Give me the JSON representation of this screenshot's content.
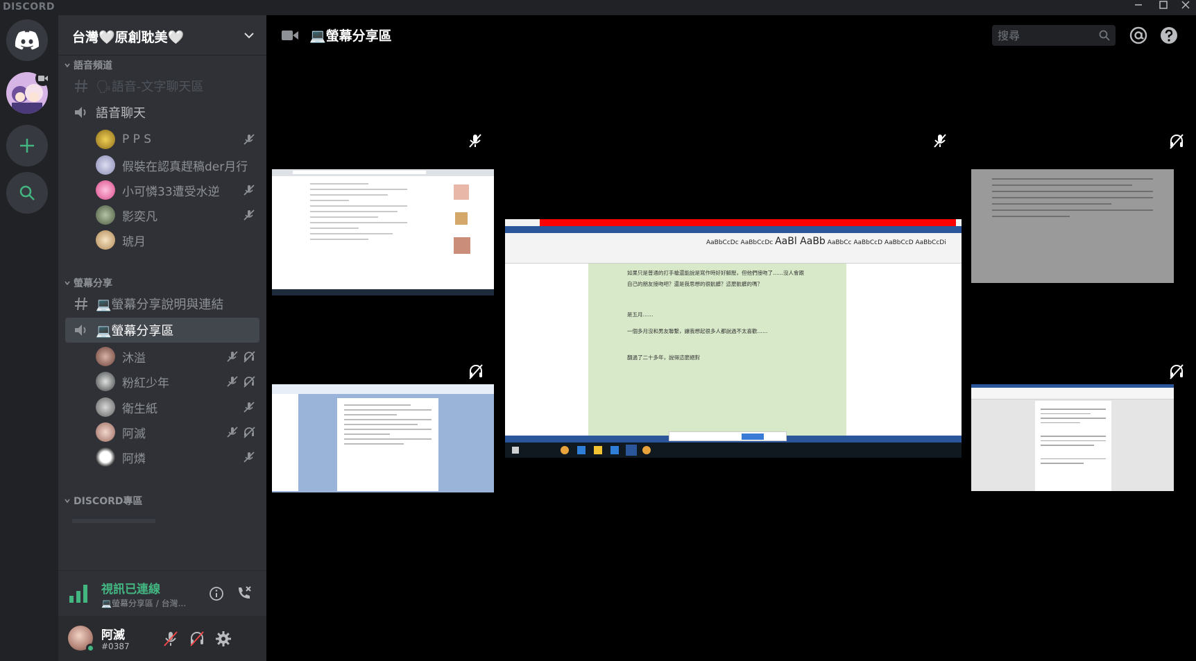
{
  "app": {
    "brand": "DISCORD"
  },
  "server": {
    "name": "台灣🤍原創耽美🤍"
  },
  "categories": {
    "voice": "語音頻道",
    "screen": "螢幕分享",
    "discord": "DISCORD專區"
  },
  "channels": {
    "voice_text": "🗣語音-文字聊天區",
    "voice_chat": "語音聊天",
    "screen_info": "💻螢幕分享說明與連結",
    "screen_area": "💻螢幕分享區"
  },
  "voice_chat_users": [
    {
      "name": "P P S",
      "color": "#c9a227"
    },
    {
      "name": "假裝在認真趕稿der月行",
      "color": "#b4b6d8"
    },
    {
      "name": "小可憐33遭受水逆",
      "color": "#e66fa9"
    },
    {
      "name": "影奕凡",
      "color": "#7b8a6e"
    },
    {
      "name": "琥月",
      "color": "#d8b98a"
    }
  ],
  "screen_share_users": [
    {
      "name": "沐溢",
      "color": "#9a6b5c"
    },
    {
      "name": "粉紅少年",
      "color": "#7a8080"
    },
    {
      "name": "衛生紙",
      "color": "#8c8c8c"
    },
    {
      "name": "阿滅",
      "color": "#c99b8e"
    },
    {
      "name": "阿燐",
      "color": "#e8e8e8"
    }
  ],
  "connection": {
    "status": "視訊已連線",
    "location": "💻螢幕分享區 / 台灣..."
  },
  "user": {
    "name": "阿滅",
    "tag": "#0387"
  },
  "topbar": {
    "channel_title": "💻螢幕分享區",
    "search_placeholder": "搜尋"
  },
  "doc_text": {
    "lines": [
      "如果只是普通的打手槍還能說是寫作時好好解壓，但他們接吻了……沒人會跟自己的朋友接吻吧？還是我思想的很骯髒？這麼骯髒的嗎？",
      "是五月……",
      "一個多月沒和男友聯繫，讓我想起很多人都說過不太喜歡……",
      "翻過了二十多年，說得這麼絕對"
    ]
  },
  "colors": {
    "green": "#43b581",
    "blurple": "#7289da",
    "bg_dark": "#202225",
    "sidebar": "#2f3136"
  }
}
